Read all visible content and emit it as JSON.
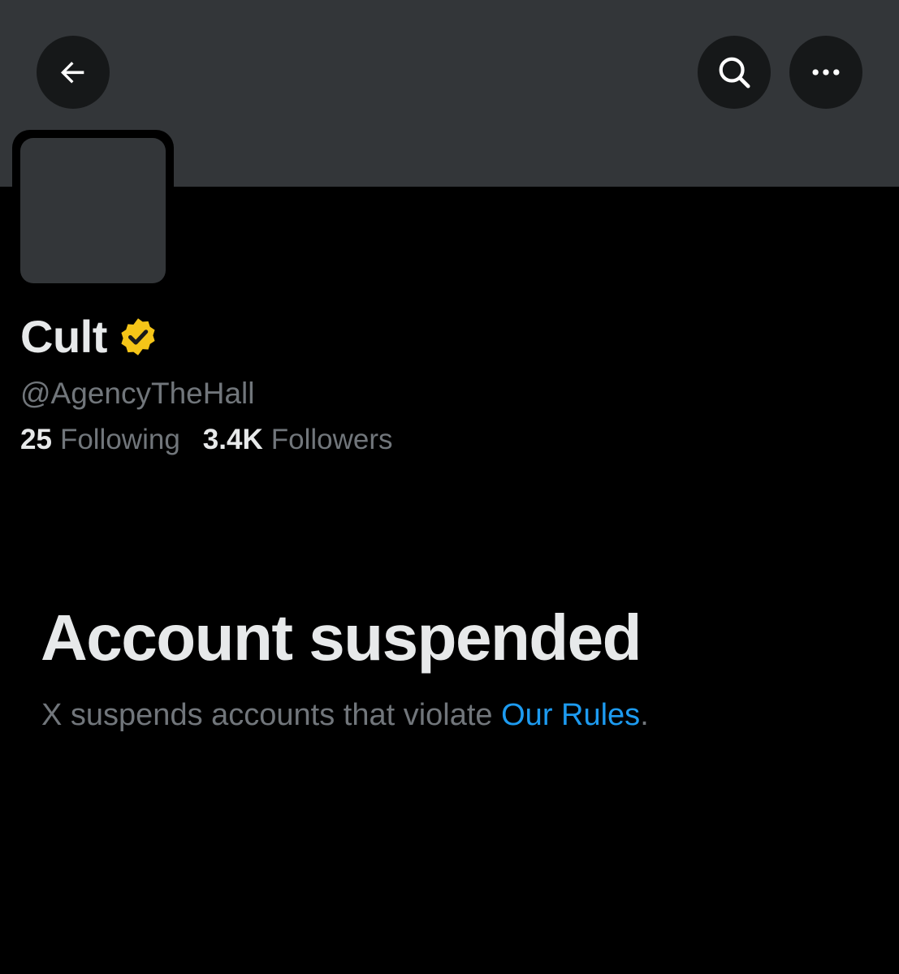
{
  "header": {
    "back_icon": "arrow-left-icon",
    "search_icon": "search-icon",
    "more_icon": "more-horizontal-icon"
  },
  "profile": {
    "display_name": "Cult",
    "verified_badge_icon": "verified-badge-icon",
    "verified_color": "#f5c518",
    "handle": "@AgencyTheHall",
    "following_count": "25",
    "following_label": "Following",
    "followers_count": "3.4K",
    "followers_label": "Followers"
  },
  "notice": {
    "title": "Account suspended",
    "description_prefix": "X suspends accounts that violate ",
    "link_text": "Our Rules",
    "description_suffix": "."
  },
  "colors": {
    "background": "#000000",
    "banner": "#333639",
    "primary_text": "#e7e9ea",
    "secondary_text": "#71767b",
    "link": "#1d9bf0"
  }
}
